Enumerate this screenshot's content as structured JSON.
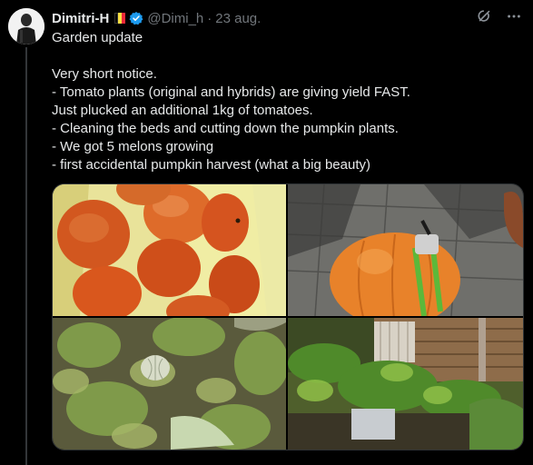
{
  "tweet": {
    "author_name": "Dimitri-H",
    "handle": "@Dimi_h",
    "separator": "·",
    "date": "23 aug.",
    "text": "Garden update\n\nVery short notice.\n- Tomato plants (original and hybrids) are giving yield FAST.\nJust plucked an additional 1kg of tomatoes.\n- Cleaning the beds and cutting down the pumpkin plants.\n- We got 5 melons growing\n- first accidental pumpkin harvest (what a big beauty)"
  },
  "icons": {
    "flag": "belgium-flag-icon",
    "verified": "verified-badge-icon",
    "grok": "grok-icon",
    "more": "more-icon"
  },
  "colors": {
    "background": "#000000",
    "text": "#e7e9ea",
    "muted": "#71767b",
    "verified": "#1d9bf0"
  }
}
